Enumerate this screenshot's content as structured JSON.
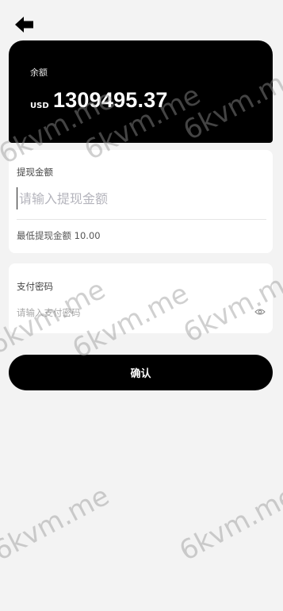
{
  "balance": {
    "label": "余额",
    "currency": "USD",
    "amount": "1309495.37"
  },
  "withdraw": {
    "label": "提现金额",
    "placeholder": "请输入提现金额",
    "min_hint": "最低提现金额 10.00"
  },
  "password": {
    "label": "支付密码",
    "placeholder": "请输入支付密码"
  },
  "confirm_label": "确认",
  "watermark": "6kvm.me",
  "icons": [
    "back-arrow-icon",
    "eye-icon"
  ]
}
